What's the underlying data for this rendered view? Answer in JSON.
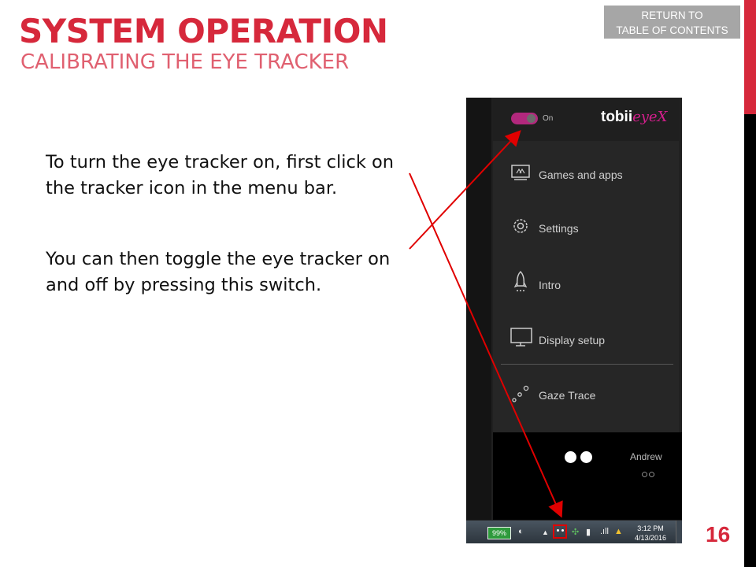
{
  "slide": {
    "title": "SYSTEM OPERATION",
    "subtitle": "CALIBRATING THE EYE TRACKER",
    "toc_line1": "RETURN TO",
    "toc_line2": "TABLE OF CONTENTS",
    "paragraph1": "To turn the eye tracker on, first click on the tracker icon in the menu bar.",
    "paragraph2": "You can then toggle the eye tracker on and off by pressing this switch.",
    "page_number": "16",
    "accent_color": "#d6283b"
  },
  "tobii": {
    "toggle_label": "On",
    "brand_main": "tobii",
    "brand_sub": "eyeX",
    "menu": [
      {
        "label": "Games and apps",
        "icon": "games-apps-icon"
      },
      {
        "label": "Settings",
        "icon": "gear-icon"
      },
      {
        "label": "Intro",
        "icon": "rocket-icon"
      },
      {
        "label": "Display setup",
        "icon": "monitor-icon"
      },
      {
        "label": "Gaze Trace",
        "icon": "gaze-trace-icon"
      }
    ],
    "user_name": "Andrew",
    "accent_color": "#b2287d"
  },
  "taskbar": {
    "battery": "99%",
    "time": "3:12 PM",
    "date": "4/13/2016"
  }
}
